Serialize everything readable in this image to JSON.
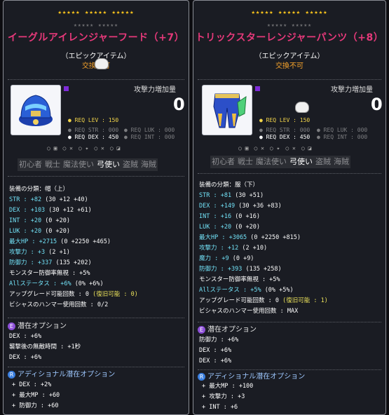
{
  "left": {
    "stars_top": "★★★★★ ★★★★★ ★★★★★",
    "stars_bottom": "★★★★★ ★★★★★",
    "name": "イーグルアイレンジャーフード（+7）",
    "grade": "（エピックアイテム）",
    "trade": "交換不可",
    "atk_label": "攻撃力増加量",
    "atk_value": "0",
    "req": {
      "lev": "● REQ LEV : 150",
      "str": "● REQ STR : 000",
      "luk": "● REQ LUK : 000",
      "dex": "● REQ DEX : 450",
      "int": "● REQ INT : 000"
    },
    "jobs": [
      "初心者",
      "戦士",
      "魔法使い",
      "弓使い",
      "盗賊",
      "海賊"
    ],
    "stats": [
      {
        "a": "装備の分類：帽（上）"
      },
      {
        "a": "STR : +82 ",
        "b": "(30 +12 +40)"
      },
      {
        "a": "DEX : +103 ",
        "b": "(30 +12 +61)"
      },
      {
        "a": "INT : +20 ",
        "b": "(0 +20)"
      },
      {
        "a": "LUK : +20 ",
        "b": "(0 +20)"
      },
      {
        "a": "最大HP : +2715 ",
        "b": "(0 +2250 +465)"
      },
      {
        "a": "攻撃力 : +3 ",
        "b": "(2 +1)"
      },
      {
        "a": "防御力 : +337 ",
        "b": "(135 +202)"
      },
      {
        "a": "モンスター防御率無視 : +5%"
      },
      {
        "a": "Allステータス : +6% ",
        "b": "(0% +6%)"
      },
      {
        "a": "アップグレード可能回数 : 0 ",
        "b": "(復旧可能 : 0)"
      },
      {
        "a": "ビシャスのハンマー使用回数 : 0/2"
      }
    ],
    "pot_title": "潜在オプション",
    "pot_lines": [
      "DEX : +6%",
      "襲撃後の無敵時間 : +1秒",
      "DEX : +6%"
    ],
    "add_title": "アディショナル潜在オプション",
    "add_lines": [
      "+ DEX : +2%",
      "+ 最大MP : +60",
      "+ 防御力 : +60"
    ]
  },
  "right": {
    "stars_top": "★★★★★ ★★★★★ ★★★★★",
    "stars_bottom": "★★★★★ ★★★★★",
    "name": "トリックスターレンジャーパンツ（+8）",
    "grade": "（エピックアイテム）",
    "trade": "交換不可",
    "atk_label": "攻撃力増加量",
    "atk_value": "0",
    "req": {
      "lev": "● REQ LEV : 150",
      "str": "● REQ STR : 000",
      "luk": "● REQ LUK : 000",
      "dex": "● REQ DEX : 450",
      "int": "● REQ INT : 000"
    },
    "jobs": [
      "初心者",
      "戦士",
      "魔法使い",
      "弓使い",
      "盗賊",
      "海賊"
    ],
    "stats": [
      {
        "a": "装備の分類：服（下）"
      },
      {
        "a": "STR : +81 ",
        "b": "(30 +51)"
      },
      {
        "a": "DEX : +149 ",
        "b": "(30 +36 +83)"
      },
      {
        "a": "INT : +16 ",
        "b": "(0 +16)"
      },
      {
        "a": "LUK : +20 ",
        "b": "(0 +20)"
      },
      {
        "a": "最大HP : +3065 ",
        "b": "(0 +2250 +815)"
      },
      {
        "a": "攻撃力 : +12 ",
        "b": "(2 +10)"
      },
      {
        "a": "魔力 : +9 ",
        "b": "(0 +9)"
      },
      {
        "a": "防御力 : +393 ",
        "b": "(135 +258)"
      },
      {
        "a": "モンスター防御率無視 : +5%"
      },
      {
        "a": "Allステータス : +5% ",
        "b": "(0% +5%)"
      },
      {
        "a": "アップグレード可能回数 : 0 ",
        "b": "(復旧可能 : 1)"
      },
      {
        "a": "ビシャスのハンマー使用回数 : MAX"
      }
    ],
    "pot_title": "潜在オプション",
    "pot_lines": [
      "防御力 : +6%",
      "DEX : +6%",
      "DEX : +6%"
    ],
    "add_title": "アディショナル潜在オプション",
    "add_lines": [
      "+ 最大MP : +100",
      "+ 攻撃力 : +3",
      "+ INT : +6"
    ]
  },
  "colors": {
    "name": "#e6397a",
    "stars": "#f7c21c",
    "trade": "#f7a32b",
    "stat_cyan": "#71e0f5",
    "pot_E": "#8d4fd8",
    "add_R": "#3a7fe0"
  }
}
